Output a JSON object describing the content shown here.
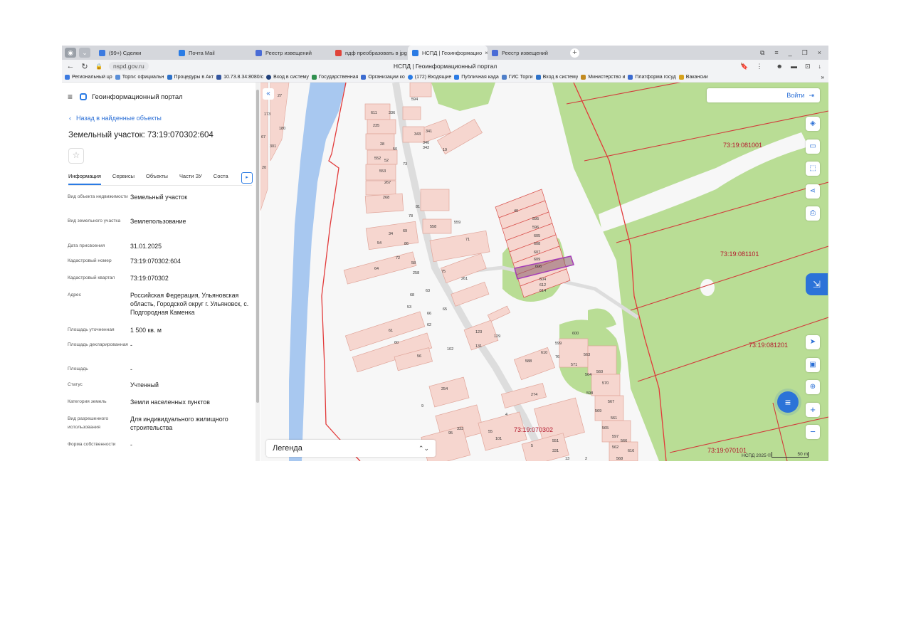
{
  "browser": {
    "tabs": [
      {
        "label": "(99+) Сделки",
        "icon_color": "#3d7be0",
        "active": false
      },
      {
        "label": "Почта Mail",
        "icon_color": "#2a7ce5",
        "active": false
      },
      {
        "label": "Реестр извещений",
        "icon_color": "#4a6cd6",
        "active": false
      },
      {
        "label": "пдф преобразовать в jpg",
        "icon_color": "#e0443a",
        "active": false
      },
      {
        "label": "НСПД | Геоинформацио",
        "icon_color": "#2b7be4",
        "active": true,
        "close": "×"
      },
      {
        "label": "Реестр извещений",
        "icon_color": "#4a6cd6",
        "active": false
      }
    ],
    "new_tab": "+",
    "window_controls": [
      "⧉",
      "≡",
      "_",
      "❐",
      "×"
    ],
    "url": "nspd.gov.ru",
    "page_title": "НСПД | Геоинформационный портал",
    "nav": {
      "back": "←",
      "reload": "↻",
      "lock": "🔒"
    },
    "addr_icons": [
      "🔖",
      "⋮",
      "☻",
      "▬",
      "⊡",
      "↓"
    ],
    "bookmarks": [
      {
        "label": "Региональный цо",
        "color": "#3d7be0"
      },
      {
        "label": "Торги: официальн",
        "color": "#5a8fd8"
      },
      {
        "label": "Процедуры в Акт",
        "color": "#2e72c9"
      },
      {
        "label": "10.73.8.34:8080/c",
        "color": "#3456a0"
      },
      {
        "label": "Вход в систему",
        "color": "#1f3f7a"
      },
      {
        "label": "Государственная",
        "color": "#2f8f4e"
      },
      {
        "label": "Организации ко",
        "color": "#3b6bd0"
      },
      {
        "label": "(172) Входящие",
        "color": "#2a7ce5"
      },
      {
        "label": "Публичная када",
        "color": "#2b7be4"
      },
      {
        "label": "ГИС Торги",
        "color": "#4f7fc9"
      },
      {
        "label": "Вход в систему",
        "color": "#2e72c9"
      },
      {
        "label": "Министерство и",
        "color": "#c28a1f"
      },
      {
        "label": "Платформа госуд",
        "color": "#3b6bd0"
      },
      {
        "label": "Вакансии",
        "color": "#d6a21d"
      }
    ],
    "bookmarks_more": "»"
  },
  "panel": {
    "app_title": "Геоинформационный портал",
    "menu_icon": "≡",
    "back_link": "Назад в найденные объекты",
    "back_arrow": "‹",
    "object_title": "Земельный участок: 73:19:070302:604",
    "favorite_icon": "☆",
    "tabs": [
      "Информация",
      "Сервисы",
      "Объекты",
      "Части ЗУ",
      "Соста"
    ],
    "tabs_more": "▸",
    "properties": [
      {
        "label": "Вид объекта недвижимости",
        "value": "Земельный участок"
      },
      {
        "label": "Вид земельного участка",
        "value": "Землепользование"
      },
      {
        "label": "Дата присвоения",
        "value": "31.01.2025"
      },
      {
        "label": "Кадастровый номер",
        "value": "73:19:070302:604"
      },
      {
        "label": "Кадастровый квартал",
        "value": "73:19:070302"
      },
      {
        "label": "Адрес",
        "value": "Российская Федерация, Ульяновская область, Городской округ г. Ульяновск, с. Подгородная Каменка"
      },
      {
        "label": "Площадь уточненная",
        "value": "1 500 кв. м"
      },
      {
        "label": "Площадь декларированная",
        "value": "-"
      },
      {
        "label": "Площадь",
        "value": "-"
      },
      {
        "label": "Статус",
        "value": "Учтенный"
      },
      {
        "label": "Категория земель",
        "value": "Земли населенных пунктов"
      },
      {
        "label": "Вид разрешенного использования",
        "value": "Для индивидуального жилищного строительства"
      },
      {
        "label": "Форма собственности",
        "value": "-"
      }
    ]
  },
  "map": {
    "login_label": "Войти",
    "login_icon": "⇥",
    "collapse_icon": "«",
    "legend_label": "Легенда",
    "legend_arrow": "⌃⌄",
    "copyright": "НСПД 2025 ©",
    "scale": "50 m",
    "quarters": [
      "73:19:081001",
      "73:19:081101",
      "73:19:081201",
      "73:19:070302",
      "73:19:070101"
    ],
    "parcel_labels": [
      "611",
      "336",
      "235",
      "343",
      "341",
      "340",
      "342",
      "19",
      "28",
      "552",
      "553",
      "267",
      "268",
      "34",
      "558",
      "559",
      "71",
      "64",
      "258",
      "261",
      "612",
      "614",
      "604",
      "606",
      "609",
      "607",
      "608",
      "605",
      "596",
      "595",
      "40",
      "61",
      "60",
      "56",
      "102",
      "123",
      "129",
      "131",
      "254",
      "274",
      "588",
      "610",
      "76",
      "599",
      "600",
      "563",
      "571",
      "564",
      "560",
      "570",
      "598",
      "567",
      "569",
      "561",
      "565",
      "597",
      "562",
      "566",
      "616",
      "568",
      "333",
      "95",
      "55",
      "551",
      "331",
      "13",
      "2",
      "594",
      "27",
      "173",
      "180",
      "301",
      "67",
      "20",
      "54",
      "52",
      "50",
      "73",
      "75",
      "69",
      "86",
      "81",
      "78",
      "72",
      "58",
      "68",
      "53",
      "66",
      "63",
      "62",
      "65",
      "101",
      "4",
      "5",
      "9",
      "57"
    ],
    "colors": {
      "water": "#a8c8f0",
      "forest": "#b9dd95",
      "parcel_fill": "#f6d6cf",
      "parcel_stroke": "#e0a59a",
      "boundary": "#e23a3a",
      "selected": "#a53db8",
      "accent": "#2b73d8"
    }
  },
  "tools": [
    "layers-icon",
    "ruler-icon",
    "select-icon",
    "share-icon",
    "print-icon",
    "locate-icon",
    "wallet-icon",
    "search-pin-icon",
    "zoom-in-icon",
    "zoom-out-icon"
  ]
}
